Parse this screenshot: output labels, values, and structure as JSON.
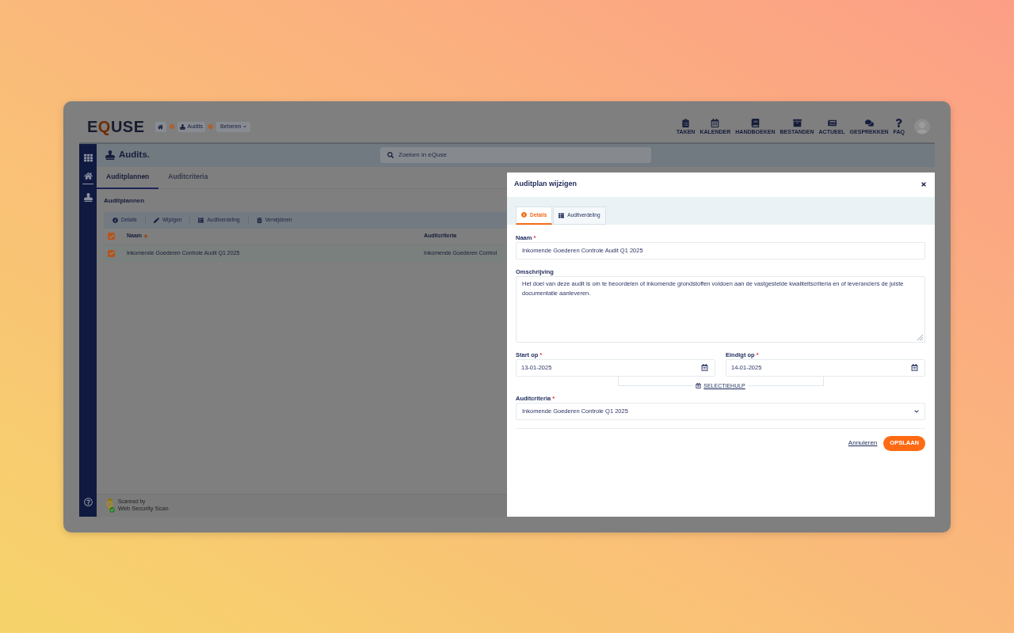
{
  "header": {
    "logo": {
      "before": "E",
      "accent": "Q",
      "after": "USE"
    },
    "breadcrumb": [
      {
        "kind": "home"
      },
      {
        "kind": "link",
        "label": "Audits"
      },
      {
        "kind": "dropdown",
        "label": "Beheren"
      }
    ],
    "nav": [
      {
        "label": "TAKEN"
      },
      {
        "label": "KALENDER"
      },
      {
        "label": "HANDBOEKEN"
      },
      {
        "label": "BESTANDEN"
      },
      {
        "label": "ACTUEEL"
      },
      {
        "label": "GESPREKKEN"
      },
      {
        "label": "FAQ"
      }
    ]
  },
  "page": {
    "title": "Audits",
    "title_accent": ".",
    "search": {
      "placeholder": "Zoeken in eQuse"
    },
    "tabs": [
      {
        "label": "Auditplannen",
        "selected": true
      },
      {
        "label": "Auditcriteria",
        "selected": false
      }
    ],
    "section_title": "Auditplannen",
    "toolbar": [
      "Details",
      "Wijzigen",
      "Auditverdeling",
      "Verwijderen"
    ],
    "table": {
      "select_all": {
        "checked": true
      },
      "columns": [
        {
          "label": "Naam",
          "sorted": true
        },
        {
          "label": "Auditcriteria",
          "sorted": false
        }
      ],
      "rows": [
        {
          "checked": true,
          "cells": [
            "Inkomende Goederen Controle Audit Q1 2025",
            "Inkomende Goederen Control"
          ]
        }
      ]
    }
  },
  "footer": {
    "badge_caption": "Scanned by",
    "badge_title": "Web Security Scan"
  },
  "dialog": {
    "title": "Auditplan wijzigen",
    "tabs": [
      {
        "label": "Details",
        "selected": true
      },
      {
        "label": "Auditverdeling",
        "selected": false
      }
    ],
    "name_field": {
      "label": "Naam",
      "required_mark": "*",
      "value": "Inkomende Goederen Controle Audit Q1 2025"
    },
    "description_field": {
      "label": "Omschrijving",
      "value": "Het doel van deze audit is om te beoordelen of inkomende grondstoffen voldoen aan de vastgestelde kwaliteitscriteria en of leveranciers de juiste documentatie aanleveren."
    },
    "date_fields": [
      {
        "label": "Start op",
        "required_mark": "*",
        "value": "13-01-2025"
      },
      {
        "label": "Eindigt op",
        "required_mark": "*",
        "value": "14-01-2025"
      }
    ],
    "selection_helper": "SELECTIEHULP",
    "criteria_field": {
      "label": "Auditcriteria",
      "required_mark": "*",
      "value": "Inkomende Goederen Controle Q1 2025"
    },
    "actions": {
      "cancel": "Annuleren",
      "save": "OPSLAAN"
    }
  }
}
